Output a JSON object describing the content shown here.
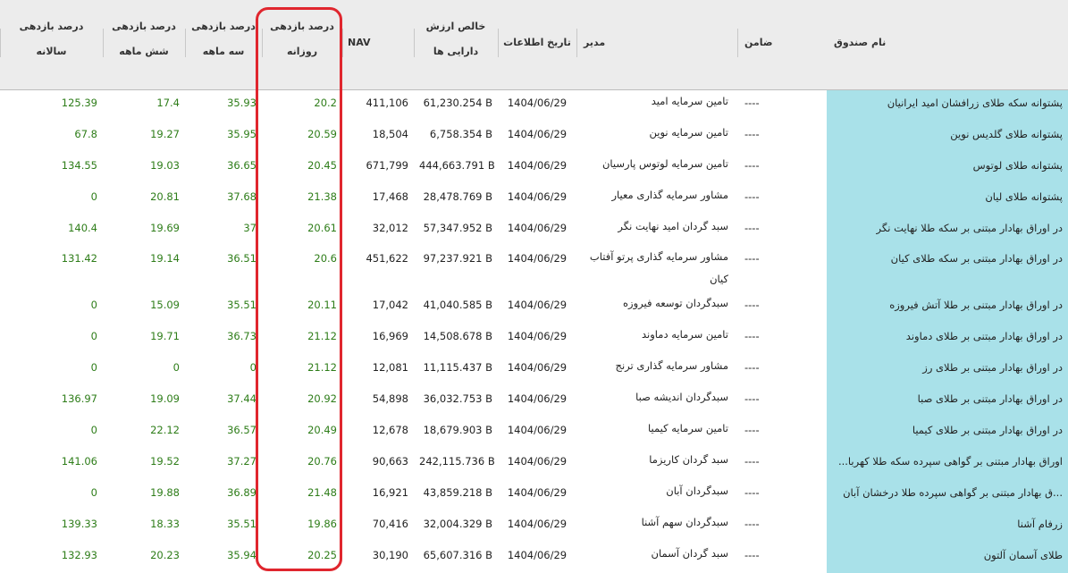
{
  "headers": {
    "name": "نام صندوق",
    "guarantor": "ضامن",
    "manager": "مدیر",
    "date": "تاریخ اطلاعات",
    "assets": [
      "خالص ارزش",
      "دارایی ها"
    ],
    "nav": "NAV",
    "daily": [
      "درصد بازدهی",
      "روزانه"
    ],
    "three_month": [
      "درصد بازدهی",
      "سه ماهه"
    ],
    "six_month": [
      "درصد بازدهی",
      "شش ماهه"
    ],
    "annual": [
      "درصد بازدهی",
      "سالانه"
    ]
  },
  "accent": {
    "highlight": "#e0262e",
    "name_cell": "#a9e1e9",
    "positive": "#2e7d19"
  },
  "rows": [
    {
      "name": "پشتوانه سکه طلای زرافشان امید ایرانیان",
      "guarantor": "----",
      "manager": "تامین سرمایه امید",
      "date": "1404/06/29",
      "assets": "61,230.254 B",
      "nav": "411,106",
      "daily": "20.2",
      "three_month": "35.93",
      "six_month": "17.4",
      "annual": "125.39"
    },
    {
      "name": "پشتوانه طلای گلدیس نوین",
      "guarantor": "----",
      "manager": "تامین سرمایه نوین",
      "date": "1404/06/29",
      "assets": "6,758.354 B",
      "nav": "18,504",
      "daily": "20.59",
      "three_month": "35.95",
      "six_month": "19.27",
      "annual": "67.8"
    },
    {
      "name": "پشتوانه طلای لوتوس",
      "guarantor": "----",
      "manager": "تامین سرمایه لوتوس پارسیان",
      "date": "1404/06/29",
      "assets": "444,663.791 B",
      "nav": "671,799",
      "daily": "20.45",
      "three_month": "36.65",
      "six_month": "19.03",
      "annual": "134.55"
    },
    {
      "name": "پشتوانه طلای لیان",
      "guarantor": "----",
      "manager": "مشاور سرمایه گذاری معیار",
      "date": "1404/06/29",
      "assets": "28,478.769 B",
      "nav": "17,468",
      "daily": "21.38",
      "three_month": "37.68",
      "six_month": "20.81",
      "annual": "0"
    },
    {
      "name": "در اوراق بهادار مبتنی بر سکه طلا نهایت نگر",
      "guarantor": "----",
      "manager": "سبد گردان امید نهایت نگر",
      "date": "1404/06/29",
      "assets": "57,347.952 B",
      "nav": "32,012",
      "daily": "20.61",
      "three_month": "37",
      "six_month": "19.69",
      "annual": "140.4"
    },
    {
      "name": "در اوراق بهادار مبتنی بر سکه طلای کیان",
      "guarantor": "----",
      "manager": "مشاور سرمایه گذاری پرتو آفتاب کیان",
      "date": "1404/06/29",
      "assets": "97,237.921 B",
      "nav": "451,622",
      "daily": "20.6",
      "three_month": "36.51",
      "six_month": "19.14",
      "annual": "131.42"
    },
    {
      "name": "در اوراق بهادار مبتنی بر طلا آتش فیروزه",
      "guarantor": "----",
      "manager": "سبدگردان توسعه فیروزه",
      "date": "1404/06/29",
      "assets": "41,040.585 B",
      "nav": "17,042",
      "daily": "20.11",
      "three_month": "35.51",
      "six_month": "15.09",
      "annual": "0"
    },
    {
      "name": "در اوراق بهادار مبتنی بر طلای دماوند",
      "guarantor": "----",
      "manager": "تامین سرمایه دماوند",
      "date": "1404/06/29",
      "assets": "14,508.678 B",
      "nav": "16,969",
      "daily": "21.12",
      "three_month": "36.73",
      "six_month": "19.71",
      "annual": "0"
    },
    {
      "name": "در اوراق بهادار مبتنی بر طلای رز",
      "guarantor": "----",
      "manager": "مشاور سرمایه گذاری ترنج",
      "date": "1404/06/29",
      "assets": "11,115.437 B",
      "nav": "12,081",
      "daily": "21.12",
      "three_month": "0",
      "six_month": "0",
      "annual": "0"
    },
    {
      "name": "در اوراق بهادار مبتنی بر طلای صبا",
      "guarantor": "----",
      "manager": "سبدگردان اندیشه صبا",
      "date": "1404/06/29",
      "assets": "36,032.753 B",
      "nav": "54,898",
      "daily": "20.92",
      "three_month": "37.44",
      "six_month": "19.09",
      "annual": "136.97"
    },
    {
      "name": "در اوراق بهادار مبتنی بر طلای کیمیا",
      "guarantor": "----",
      "manager": "تامین سرمایه کیمیا",
      "date": "1404/06/29",
      "assets": "18,679.903 B",
      "nav": "12,678",
      "daily": "20.49",
      "three_month": "36.57",
      "six_month": "22.12",
      "annual": "0"
    },
    {
      "name": "اوراق بهادار مبتنی بر گواهی سپرده سکه طلا کهربا...",
      "guarantor": "----",
      "manager": "سبد گردان کاریزما",
      "date": "1404/06/29",
      "assets": "242,115.736 B",
      "nav": "90,663",
      "daily": "20.76",
      "three_month": "37.27",
      "six_month": "19.52",
      "annual": "141.06"
    },
    {
      "name": "...ق بهادار مبتنی بر گواهی سپرده طلا درخشان آبان",
      "guarantor": "----",
      "manager": "سبدگردان آبان",
      "date": "1404/06/29",
      "assets": "43,859.218 B",
      "nav": "16,921",
      "daily": "21.48",
      "three_month": "36.89",
      "six_month": "19.88",
      "annual": "0"
    },
    {
      "name": "زرفام آشنا",
      "guarantor": "----",
      "manager": "سبدگردان سهم آشنا",
      "date": "1404/06/29",
      "assets": "32,004.329 B",
      "nav": "70,416",
      "daily": "19.86",
      "three_month": "35.51",
      "six_month": "18.33",
      "annual": "139.33"
    },
    {
      "name": "طلای آسمان آلتون",
      "guarantor": "----",
      "manager": "سبد گردان آسمان",
      "date": "1404/06/29",
      "assets": "65,607.316 B",
      "nav": "30,190",
      "daily": "20.25",
      "three_month": "35.94",
      "six_month": "20.23",
      "annual": "132.93"
    }
  ]
}
